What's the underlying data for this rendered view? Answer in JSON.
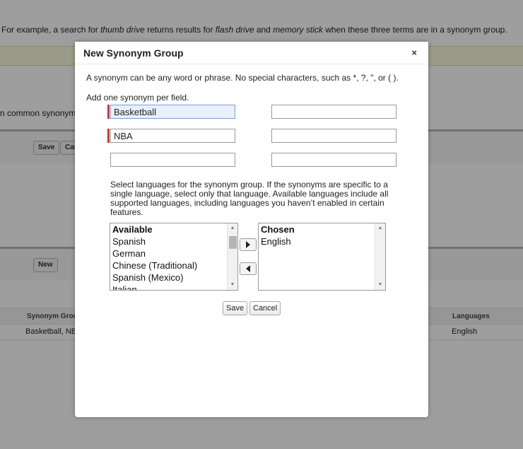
{
  "background": {
    "intro": {
      "prefix": "For example, a search for ",
      "term1": "thumb drive",
      "mid1": " returns results for ",
      "term2": "flash drive",
      "mid2": " and ",
      "term3": "memory stick",
      "suffix": " when these three terms are in a synonym group."
    },
    "common_text": "n common synonym",
    "save_label": "Save",
    "cancel_label_partial": "Car",
    "new_label": "New",
    "table": {
      "col_synonym_group": "Synonym Grou",
      "col_languages": "Languages",
      "row_synonym_group": "Basketball, NB",
      "row_languages": "English"
    }
  },
  "modal": {
    "title": "New Synonym Group",
    "close_glyph": "×",
    "description": "A synonym can be any word or phrase. No special characters, such as *, ?, \", or ( ).",
    "add_label": "Add one synonym per field.",
    "fields": {
      "f1": "Basketball",
      "f2": "",
      "f3": "NBA",
      "f4": "",
      "f5": "",
      "f6": ""
    },
    "language_description": "Select languages for the synonym group. If the synonyms are specific to a single language, select only that language. Available languages include all supported languages, including languages you haven’t enabled in certain features.",
    "available": {
      "header": "Available",
      "items": [
        "Spanish",
        "German",
        "Chinese (Traditional)",
        "Spanish (Mexico)",
        "Italian"
      ]
    },
    "chosen": {
      "header": "Chosen",
      "items": [
        "English"
      ]
    },
    "save_label": "Save",
    "cancel_label": "Cancel"
  },
  "icons": {
    "close": "close-icon",
    "add": "arrow-right-icon",
    "remove": "arrow-left-icon"
  }
}
